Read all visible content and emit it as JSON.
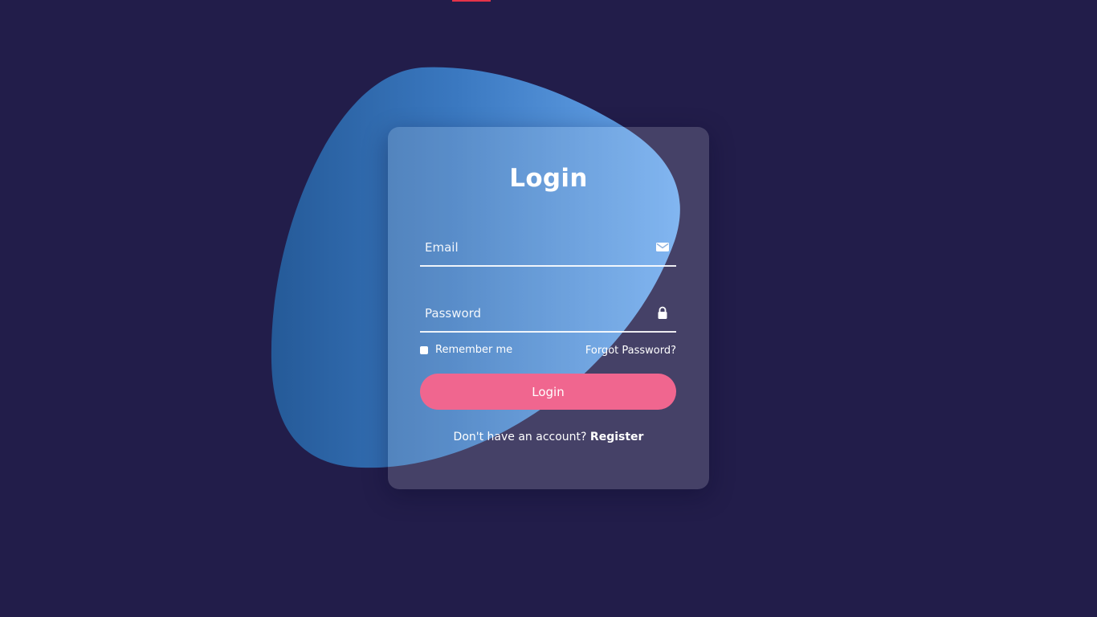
{
  "colors": {
    "background": "#221d4a",
    "accent": "#f0668f",
    "blob_start": "#2a5fa0",
    "blob_end": "#5aa0ea",
    "top_accent": "#e53349"
  },
  "form": {
    "title": "Login",
    "email_placeholder": "Email",
    "email_icon": "envelope-icon",
    "password_placeholder": "Password",
    "password_icon": "lock-icon",
    "remember_label": "Remember me",
    "forgot_label": "Forgot Password?",
    "login_button": "Login",
    "no_account_text": "Don't have an account?",
    "register_link": "Register"
  }
}
